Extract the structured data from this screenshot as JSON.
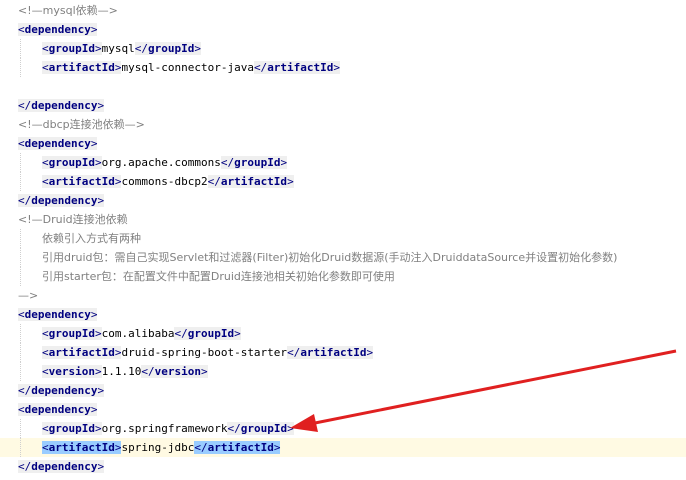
{
  "lines": [
    {
      "type": "comment",
      "text": "<!—mysql依赖—>"
    },
    {
      "type": "tag",
      "indent": 0,
      "name": "dependency",
      "open": true
    },
    {
      "type": "elem",
      "indent": 1,
      "name": "groupId",
      "value": "mysql"
    },
    {
      "type": "elem",
      "indent": 1,
      "name": "artifactId",
      "value": "mysql-connector-java"
    },
    {
      "type": "blank"
    },
    {
      "type": "tag",
      "indent": 0,
      "name": "dependency",
      "open": false
    },
    {
      "type": "comment",
      "text": "<!—dbcp连接池依赖—>"
    },
    {
      "type": "tag",
      "indent": 0,
      "name": "dependency",
      "open": true
    },
    {
      "type": "elem",
      "indent": 1,
      "name": "groupId",
      "value": "org.apache.commons"
    },
    {
      "type": "elem",
      "indent": 1,
      "name": "artifactId",
      "value": "commons-dbcp2"
    },
    {
      "type": "tag",
      "indent": 0,
      "name": "dependency",
      "open": false
    },
    {
      "type": "comment",
      "text": "<!—Druid连接池依赖"
    },
    {
      "type": "comment",
      "indent": 1,
      "text": "依赖引入方式有两种"
    },
    {
      "type": "comment",
      "indent": 1,
      "text": "引用druid包：需自己实现Servlet和过滤器(Filter)初始化Druid数据源(手动注入DruiddataSource并设置初始化参数)"
    },
    {
      "type": "comment",
      "indent": 1,
      "text": "引用starter包：在配置文件中配置Druid连接池相关初始化参数即可使用"
    },
    {
      "type": "comment",
      "text": "—>"
    },
    {
      "type": "tag",
      "indent": 0,
      "name": "dependency",
      "open": true
    },
    {
      "type": "elem",
      "indent": 1,
      "name": "groupId",
      "value": "com.alibaba"
    },
    {
      "type": "elem",
      "indent": 1,
      "name": "artifactId",
      "value": "druid-spring-boot-starter"
    },
    {
      "type": "elem",
      "indent": 1,
      "name": "version",
      "value": "1.1.10"
    },
    {
      "type": "tag",
      "indent": 0,
      "name": "dependency",
      "open": false
    },
    {
      "type": "tag",
      "indent": 0,
      "name": "dependency",
      "open": true
    },
    {
      "type": "elem",
      "indent": 1,
      "name": "groupId",
      "value": "org.springframework"
    },
    {
      "type": "elem",
      "indent": 1,
      "name": "artifactId",
      "value": "spring-jdbc",
      "highlight": true,
      "current": true
    },
    {
      "type": "tag",
      "indent": 0,
      "name": "dependency",
      "open": false
    }
  ],
  "colors": {
    "tag_text": "#000080",
    "tag_bg": "#efefef",
    "highlight_bg": "#99ccff",
    "current_line_bg": "#fffae3",
    "comment": "#808080",
    "arrow": "#e02020"
  }
}
